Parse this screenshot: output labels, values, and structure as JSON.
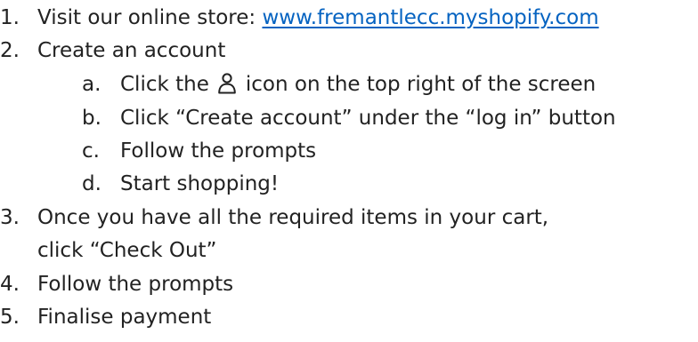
{
  "steps": [
    {
      "num": "1.",
      "text": "Visit our online store: ",
      "link": "www.fremantlecc.myshopify.com"
    },
    {
      "num": "2.",
      "text": "Create an account",
      "substeps": [
        {
          "num": "a.",
          "text_before": "Click the",
          "icon": "person-icon",
          "text_after": "icon on the top right of the screen"
        },
        {
          "num": "b.",
          "text": "Click “Create account” under the “log in” button"
        },
        {
          "num": "c.",
          "text": "Follow the prompts"
        },
        {
          "num": "d.",
          "text": "Start shopping!"
        }
      ]
    },
    {
      "num": "3.",
      "text": "Once you have all the required items in your cart,",
      "text_line2": "click “Check Out”"
    },
    {
      "num": "4.",
      "text": "Follow the prompts"
    },
    {
      "num": "5.",
      "text": "Finalise payment"
    }
  ],
  "colors": {
    "text": "#222222",
    "link": "#0563c1"
  }
}
